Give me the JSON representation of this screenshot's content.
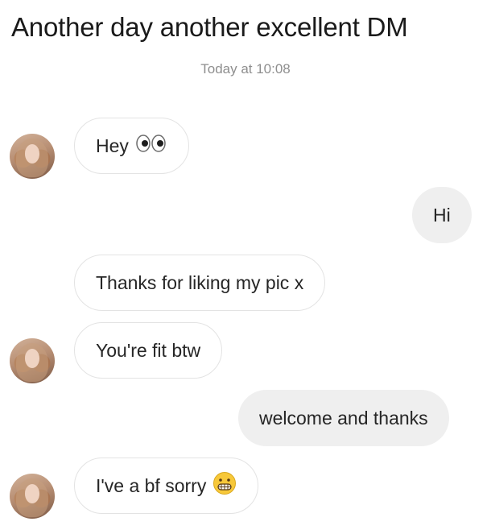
{
  "caption": "Another day another excellent DM",
  "timestamp": "Today at 10:08",
  "messages": [
    {
      "text": "Hey",
      "emoji": "eyes-emoji"
    },
    {
      "text": "Hi"
    },
    {
      "text": "Thanks for liking my pic x"
    },
    {
      "text": "You're fit btw"
    },
    {
      "text": "welcome and thanks"
    },
    {
      "text": "I've a bf sorry",
      "emoji": "grimacing-face-emoji"
    }
  ],
  "colors": {
    "incoming_bubble_bg": "#ffffff",
    "incoming_bubble_border": "#e3e3e3",
    "outgoing_bubble_bg": "#efefef",
    "timestamp": "#8e8e8e",
    "text": "#262626"
  }
}
